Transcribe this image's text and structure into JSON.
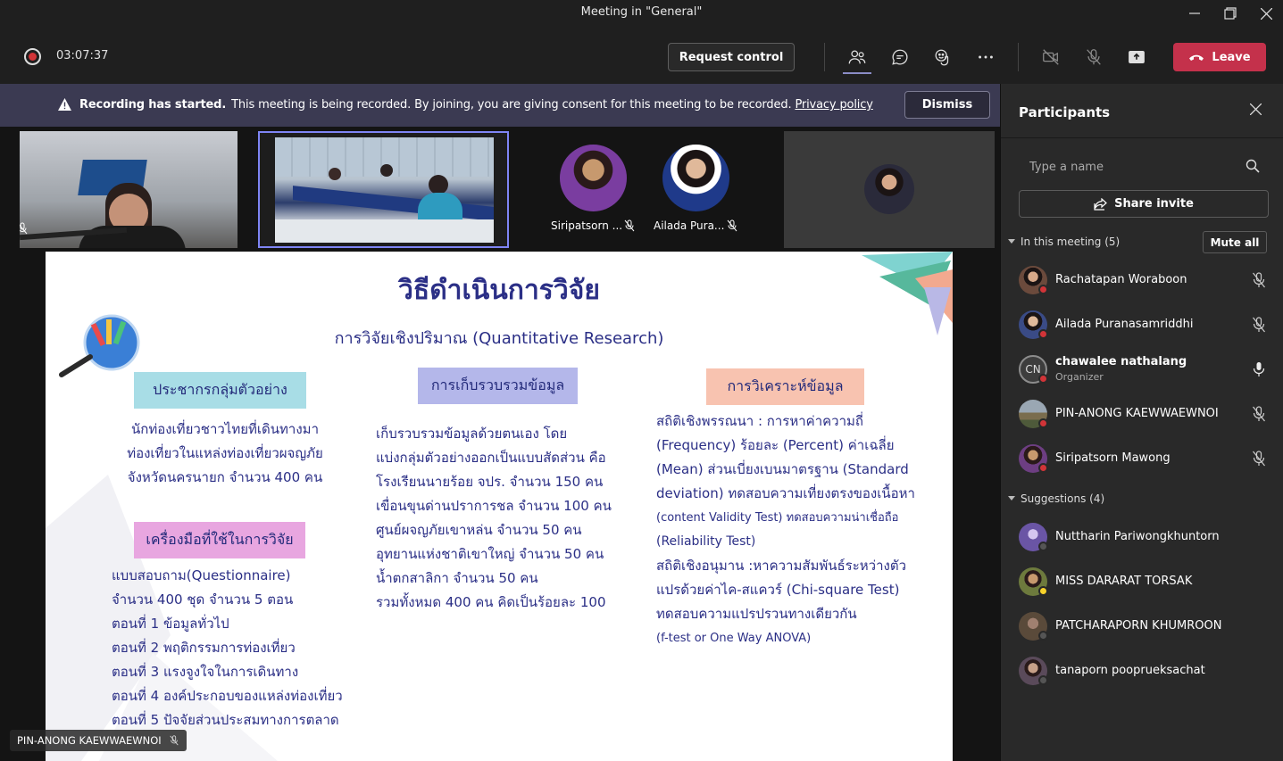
{
  "window": {
    "title": "Meeting in \"General\"",
    "minimize_icon": "minimize-icon",
    "maximize_icon": "maximize-icon",
    "close_icon": "close-icon"
  },
  "toolbar": {
    "timer": "03:07:37",
    "request_control_label": "Request control",
    "leave_label": "Leave",
    "icons": [
      "participants-icon",
      "chat-icon",
      "reactions-icon",
      "more-icon",
      "camera-off-icon",
      "mic-off-icon",
      "share-tray-icon",
      "phone-icon"
    ]
  },
  "banner": {
    "title": "Recording has started.",
    "message": "This meeting is being recorded. By joining, you are giving consent for this meeting to be recorded.",
    "link": "Privacy policy",
    "dismiss_label": "Dismiss"
  },
  "strip": {
    "tiles": [
      {
        "name": "Siripatsorn ..."
      },
      {
        "name": "Ailada Pura..."
      }
    ]
  },
  "slide": {
    "title": "วิธีดำเนินการวิจัย",
    "subtitle": "การวิจัยเชิงปริมาณ (Quantitative Research)",
    "col1_heading": "ประชากรกลุ่มตัวอย่าง",
    "col1_lines": [
      "นักท่องเที่ยวชาวไทยที่เดินทางมา",
      "ท่องเที่ยวในแหล่งท่องเที่ยวผจญภัย",
      "จังหวัดนครนายก จำนวน 400 คน"
    ],
    "col1b_heading": "เครื่องมือที่ใช้ในการวิจัย",
    "col1b_lines": [
      "แบบสอบถาม(Questionnaire)",
      "จำนวน 400 ชุด จำนวน 5 ตอน",
      "ตอนที่ 1 ข้อมูลทั่วไป",
      "ตอนที่ 2  พฤติกรรมการท่องเที่ยว",
      "ตอนที่ 3 แรงจูงใจในการเดินทาง",
      "ตอนที่ 4 องค์ประกอบของแหล่งท่องเที่ยว",
      "ตอนที่ 5 ปัจจัยส่วนประสมทางการตลาด"
    ],
    "col2_heading": "การเก็บรวบรวมข้อมูล",
    "col2_lines": [
      "เก็บรวบรวมข้อมูลด้วยตนเอง โดย",
      "แบ่งกลุ่มตัวอย่างออกเป็นแบบสัดส่วน คือ",
      "โรงเรียนนายร้อย จปร. จำนวน 150 คน",
      "เขื่อนขุนด่านปราการชล จำนวน 100 คน",
      "ศูนย์ผจญภัยเขาหล่น      จำนวน 50 คน",
      "อุทยานแห่งชาติเขาใหญ่ จำนวน 50 คน",
      "น้ำตกสาลิกา                  จำนวน 50 คน",
      "รวมทั้งหมด  400 คน คิดเป็นร้อยละ 100"
    ],
    "col3_heading": "การวิเคราะห์ข้อมูล",
    "col3_lines": [
      "สถิติเชิงพรรณนา : การหาค่าความถี่",
      "(Frequency) ร้อยละ (Percent) ค่าเฉลี่ย",
      "(Mean) ส่วนเบี่ยงเบนมาตรฐาน (Standard",
      "deviation) ทดสอบความเที่ยงตรงของเนื้อหา",
      "(content Validity Test)  ทดสอบความน่าเชื่อถือ",
      "(Reliability Test)",
      "สถิติเชิงอนุมาน :หาความสัมพันธ์ระหว่างตัว",
      "แปรด้วยค่าไค-สแควร์ (Chi-square Test)",
      "ทดสอบความแปรปรวนทางเดียวกัน",
      "(f-test or One Way ANOVA)"
    ]
  },
  "speaker": {
    "name": "PIN-ANONG KAEWWAEWNOI"
  },
  "panel": {
    "title": "Participants",
    "search_placeholder": "Type a name",
    "share_invite_label": "Share invite",
    "in_meeting_label": "In this meeting (5)",
    "mute_all_label": "Mute all",
    "suggestions_label": "Suggestions (4)",
    "in_meeting": [
      {
        "name": "Rachatapan Woraboon",
        "avatar_color": "#6b4a3c"
      },
      {
        "name": "Ailada Puranasamriddhi",
        "avatar_color": "#3a4b86"
      },
      {
        "name": "chawalee nathalang",
        "role": "Organizer",
        "initials": "CN",
        "avatar_color": "#3d3d3d"
      },
      {
        "name": "PIN-ANONG KAEWWAEWNOI",
        "avatar_color": "#7a6d4e"
      },
      {
        "name": "Siripatsorn Mawong",
        "avatar_color": "#6d3e82"
      }
    ],
    "suggestions": [
      {
        "name": "Nuttharin Pariwongkhuntorn",
        "avatar_color": "#6a55a5"
      },
      {
        "name": "MISS DARARAT TORSAK",
        "avatar_color": "#6d7a3d"
      },
      {
        "name": "PATCHARAPORN KHUMROON",
        "avatar_color": "#5a4a3a"
      },
      {
        "name": "tanaporn pooprueksachat",
        "avatar_color": "#5a4a5a"
      }
    ]
  },
  "colors": {
    "accent": "#7f85f5",
    "leave": "#c4314b",
    "banner": "#3b3a52",
    "status_red": "#d13438",
    "box_cyan": "#a8dde6",
    "box_lavender": "#b4b7ea",
    "box_pink": "#e8a6e0",
    "box_peach": "#f8c3b0"
  }
}
